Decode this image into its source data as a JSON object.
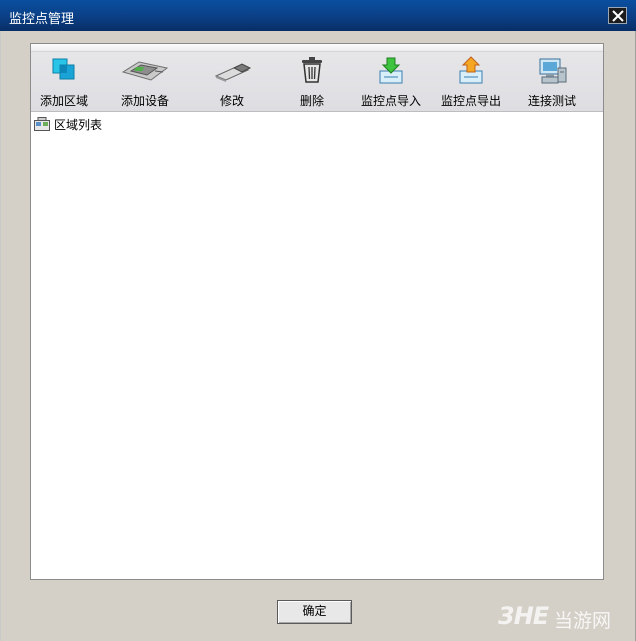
{
  "window": {
    "title": "监控点管理"
  },
  "toolbar": {
    "buttons": [
      {
        "label": "添加区域",
        "icon": "add-area-icon"
      },
      {
        "label": "添加设备",
        "icon": "add-device-icon"
      },
      {
        "label": "修改",
        "icon": "edit-icon"
      },
      {
        "label": "删除",
        "icon": "delete-icon"
      },
      {
        "label": "监控点导入",
        "icon": "import-icon"
      },
      {
        "label": "监控点导出",
        "icon": "export-icon"
      },
      {
        "label": "连接测试",
        "icon": "connection-test-icon"
      }
    ]
  },
  "tree": {
    "root_label": "区域列表",
    "root_icon": "area-list-icon"
  },
  "footer": {
    "ok_label": "确定"
  },
  "watermark": {
    "logo": "3HE",
    "text": "当游网"
  },
  "colors": {
    "titlebar": "#0b3f85",
    "dialog_bg": "#d4d0c8",
    "panel_bg": "#ffffff"
  }
}
